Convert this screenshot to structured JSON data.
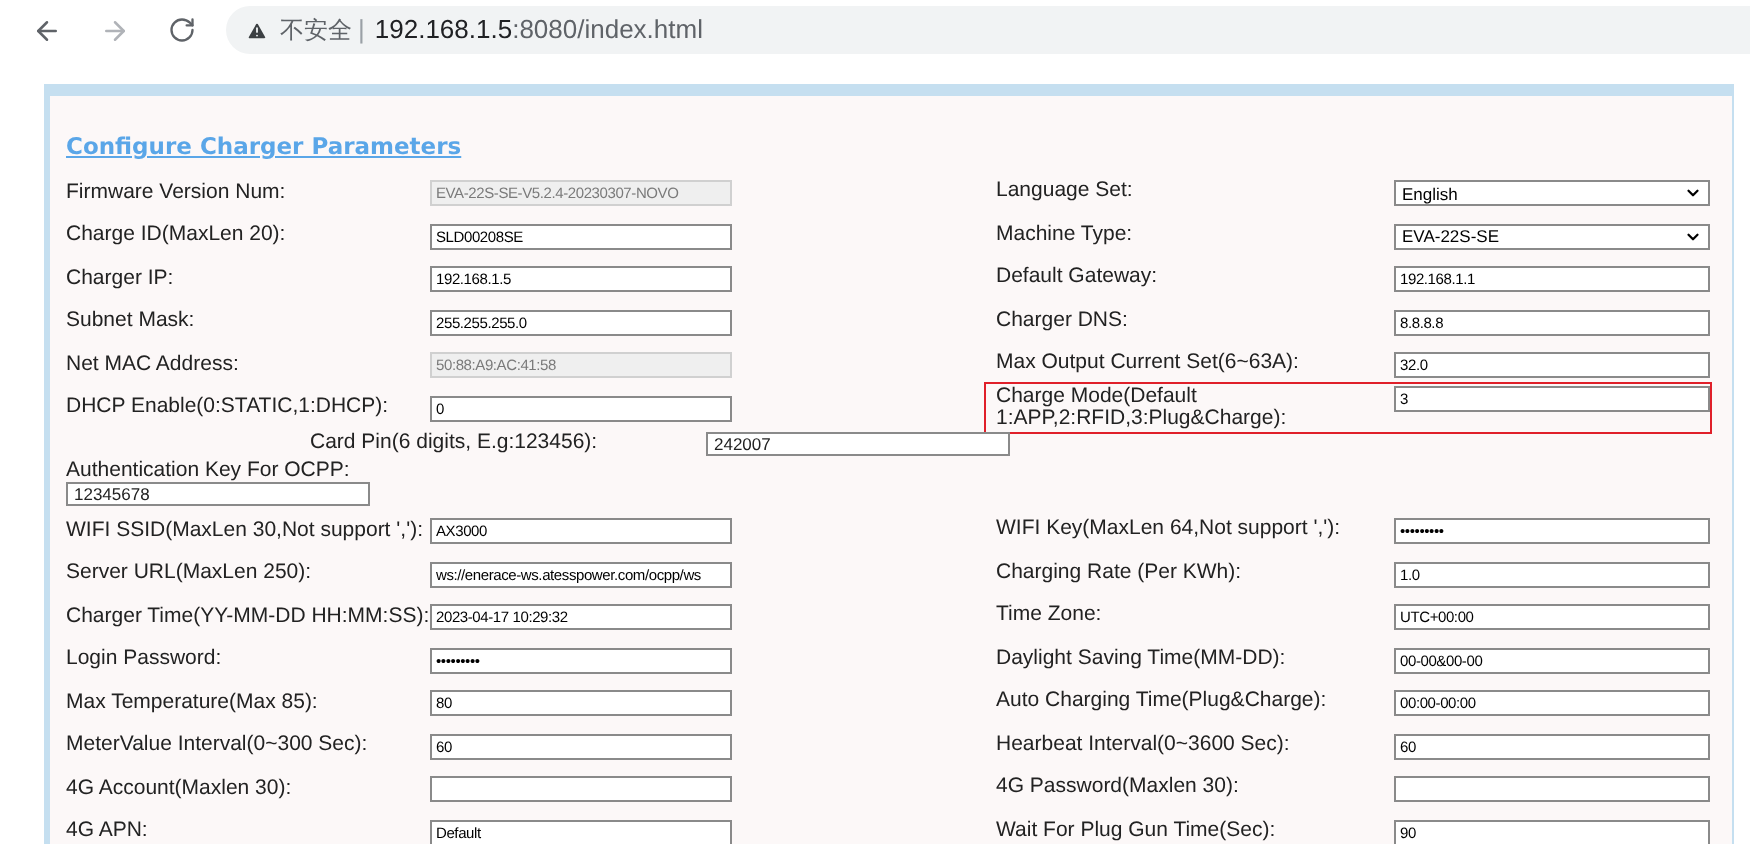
{
  "browser": {
    "security_warning": "不安全",
    "separator": "|",
    "host": "192.168.1.5",
    "path": ":8080/index.html"
  },
  "panel": {
    "title": "Configure Charger Parameters"
  },
  "rows_top": [
    {
      "left": {
        "label": "Firmware Version Num:",
        "value": "EVA-22S-SE-V5.2.4-20230307-NOVO",
        "kind": "text",
        "disabled": true
      },
      "right": {
        "label": "Language Set:",
        "value": "English",
        "kind": "select",
        "highlighted": false
      }
    },
    {
      "left": {
        "label": "Charge ID(MaxLen 20):",
        "value": "SLD00208SE",
        "kind": "text",
        "disabled": false
      },
      "right": {
        "label": "Machine Type:",
        "value": "EVA-22S-SE",
        "kind": "select",
        "highlighted": false
      }
    },
    {
      "left": {
        "label": "Charger IP:",
        "value": "192.168.1.5",
        "kind": "text",
        "disabled": false
      },
      "right": {
        "label": "Default Gateway:",
        "value": "192.168.1.1",
        "kind": "text",
        "highlighted": false
      }
    },
    {
      "left": {
        "label": "Subnet Mask:",
        "value": "255.255.255.0",
        "kind": "text",
        "disabled": false
      },
      "right": {
        "label": "Charger DNS:",
        "value": "8.8.8.8",
        "kind": "text",
        "highlighted": false
      }
    },
    {
      "left": {
        "label": "Net MAC Address:",
        "value": "50:88:A9:AC:41:58",
        "kind": "text",
        "disabled": true
      },
      "right": {
        "label": "Max Output Current Set(6~63A):",
        "value": "32.0",
        "kind": "text",
        "highlighted": false
      }
    },
    {
      "left": {
        "label": "DHCP Enable(0:STATIC,1:DHCP):",
        "value": "0",
        "kind": "text",
        "disabled": false
      },
      "right": {
        "label": "Charge Mode(Default 1:APP,2:RFID,3:Plug&Charge):",
        "value": "3",
        "kind": "text",
        "highlighted": true
      }
    }
  ],
  "card_pin": {
    "label": "Card Pin(6 digits, E.g:123456):",
    "value": "242007"
  },
  "auth_key": {
    "label": "Authentication Key For OCPP:",
    "value": "12345678"
  },
  "rows_bottom": [
    {
      "left": {
        "label": "WIFI SSID(MaxLen 30,Not support ','):",
        "value": "AX3000",
        "kind": "text",
        "disabled": false
      },
      "right": {
        "label": "WIFI Key(MaxLen 64,Not support ','):",
        "value": "•••••••••",
        "kind": "text",
        "highlighted": false
      }
    },
    {
      "left": {
        "label": "Server URL(MaxLen 250):",
        "value": "ws://enerace-ws.atesspower.com/ocpp/ws",
        "kind": "text",
        "disabled": false
      },
      "right": {
        "label": "Charging Rate (Per KWh):",
        "value": "1.0",
        "kind": "text",
        "highlighted": false
      }
    },
    {
      "left": {
        "label": "Charger Time(YY-MM-DD HH:MM:SS):",
        "value": "2023-04-17 10:29:32",
        "kind": "text",
        "disabled": false
      },
      "right": {
        "label": "Time Zone:",
        "value": "UTC+00:00",
        "kind": "text",
        "highlighted": false
      }
    },
    {
      "left": {
        "label": "Login Password:",
        "value": "•••••••••",
        "kind": "text",
        "disabled": false
      },
      "right": {
        "label": "Daylight Saving Time(MM-DD):",
        "value": "00-00&00-00",
        "kind": "text",
        "highlighted": false
      }
    },
    {
      "left": {
        "label": "Max Temperature(Max 85):",
        "value": "80",
        "kind": "text",
        "disabled": false
      },
      "right": {
        "label": "Auto Charging Time(Plug&Charge):",
        "value": "00:00-00:00",
        "kind": "text",
        "highlighted": false
      }
    },
    {
      "left": {
        "label": "MeterValue Interval(0~300 Sec):",
        "value": "60",
        "kind": "text",
        "disabled": false
      },
      "right": {
        "label": "Hearbeat Interval(0~3600 Sec):",
        "value": "60",
        "kind": "text",
        "highlighted": false
      }
    },
    {
      "left": {
        "label": "4G Account(Maxlen 30):",
        "kind": "text",
        "disabled": false
      },
      "right": {
        "label": "4G Password(Maxlen 30):",
        "kind": "text",
        "highlighted": false
      }
    },
    {
      "left": {
        "label": "4G APN:",
        "value": "Default",
        "kind": "text",
        "disabled": false
      },
      "right": {
        "label": "Wait For Plug Gun Time(Sec):",
        "value": "90",
        "kind": "text",
        "highlighted": false
      }
    }
  ]
}
